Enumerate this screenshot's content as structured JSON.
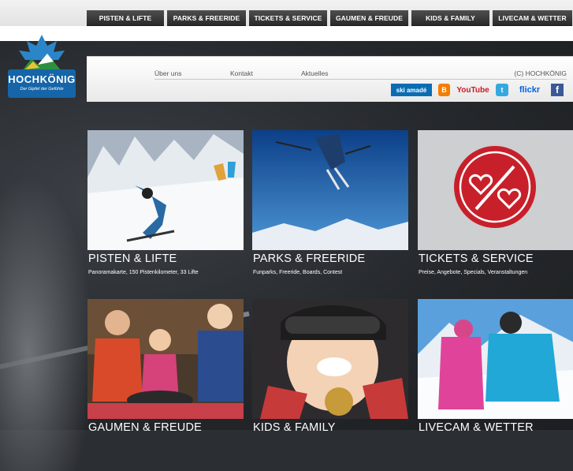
{
  "nav": {
    "tabs": [
      {
        "label": "PISTEN & LIFTE"
      },
      {
        "label": "PARKS & FREERIDE"
      },
      {
        "label": "TICKETS & SERVICE"
      },
      {
        "label": "GAUMEN & FREUDE"
      },
      {
        "label": "KIDS & FAMILY"
      },
      {
        "label": "LIVECAM & WETTER"
      }
    ]
  },
  "logo": {
    "name": "HOCHKÖNIG",
    "slogan": "Der Gipfel der Gefühle",
    "icon": "crown-mountain-logo"
  },
  "infobar": {
    "links": [
      {
        "label": "Über uns"
      },
      {
        "label": "Kontakt"
      },
      {
        "label": "Aktuelles"
      }
    ],
    "copyright": "(C) HOCHKÖNIG",
    "social": [
      {
        "label": "ski amadé",
        "icon": "ski-amade-icon",
        "color": "#0a6db3"
      },
      {
        "label": "B",
        "icon": "blogger-icon",
        "color": "#f57d00"
      },
      {
        "label": "YouTube",
        "icon": "youtube-icon",
        "color": "#cc181e"
      },
      {
        "label": "t",
        "icon": "twitter-icon",
        "color": "#33a9e0"
      },
      {
        "label": "flickr",
        "icon": "flickr-icon",
        "color": "#0063dc"
      },
      {
        "label": "f",
        "icon": "facebook-icon",
        "color": "#3b5998"
      }
    ]
  },
  "tiles": [
    {
      "title": "PISTEN & LIFTE",
      "subtitle": "Panoramakarte, 150 Pistenkilometer, 33 Lifte"
    },
    {
      "title": "PARKS & FREERIDE",
      "subtitle": "Funparks, Freeride, Boards, Contest"
    },
    {
      "title": "TICKETS & SERVICE",
      "subtitle": "Preise, Angebote, Specials, Veranstaltungen"
    },
    {
      "title": "GAUMEN & FREUDE",
      "subtitle": ""
    },
    {
      "title": "KIDS & FAMILY",
      "subtitle": ""
    },
    {
      "title": "LIVECAM & WETTER",
      "subtitle": ""
    }
  ],
  "colors": {
    "nav_bg": "#333333",
    "brand_blue": "#1565a8",
    "tickets_red": "#c8202a"
  }
}
